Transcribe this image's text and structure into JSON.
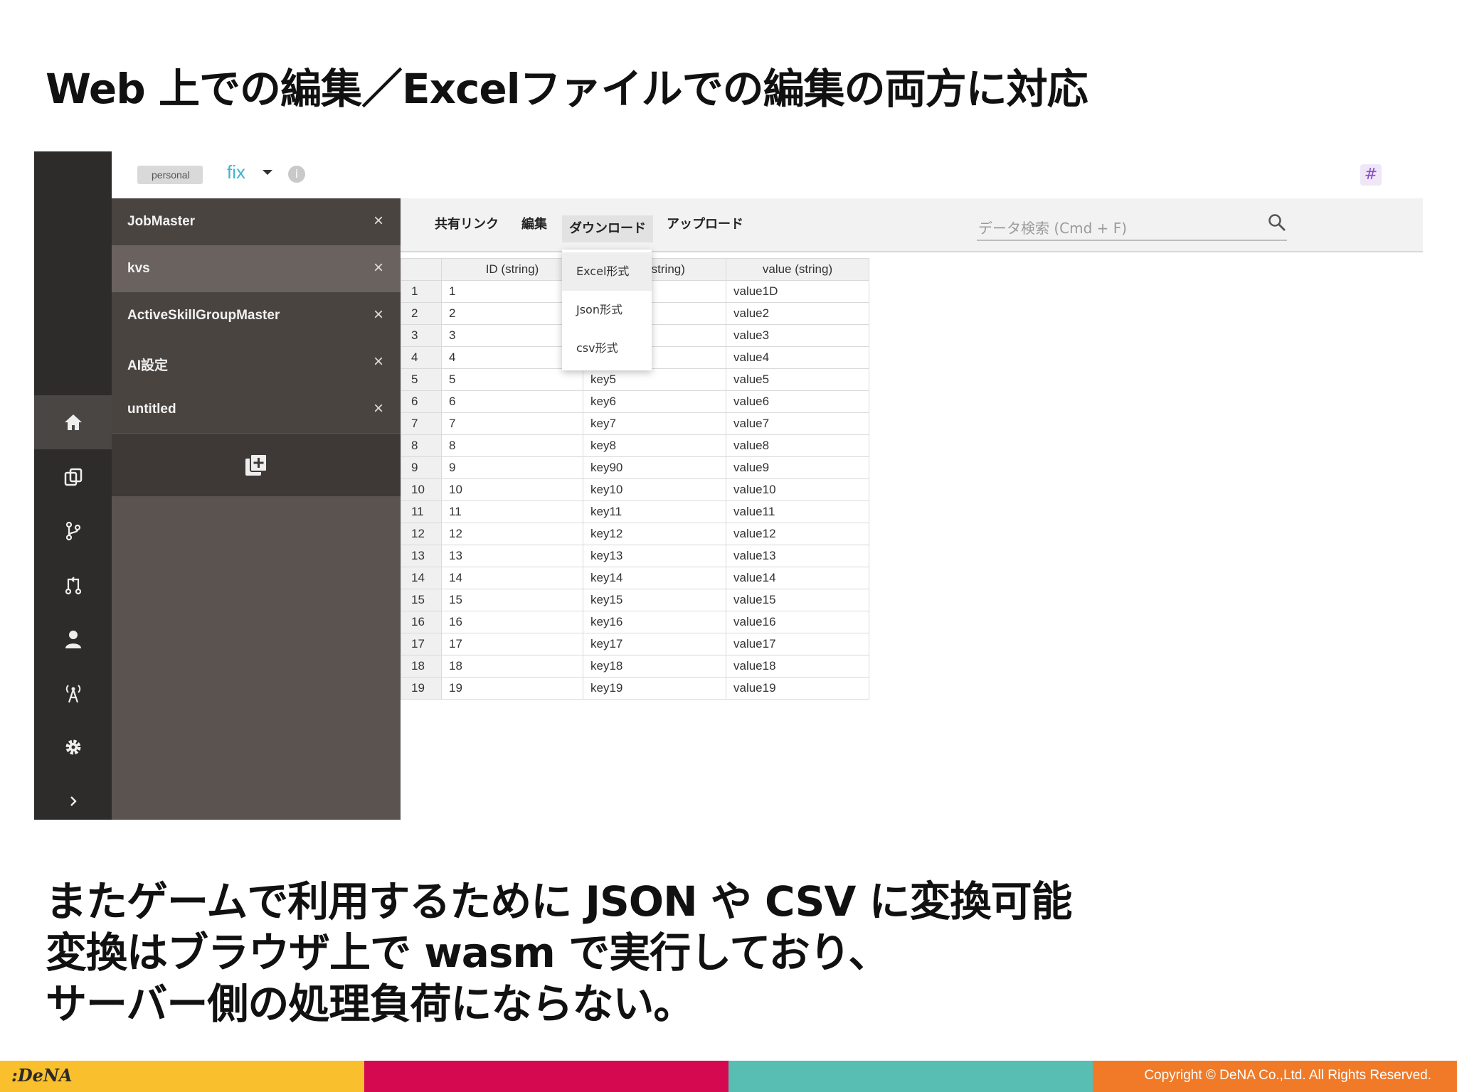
{
  "slide": {
    "title": "Web 上での編集／Excelファイルでの編集の両方に対応",
    "body_lines": [
      "またゲームで利用するために JSON や CSV に変換可能",
      "変換はブラウザ上で wasm で実行しており、",
      "サーバー側の処理負荷にならない。"
    ]
  },
  "app": {
    "env_badge": "personal",
    "branch": "fix",
    "sidebar_icons": [
      "home-icon",
      "copy-icon",
      "branch-icon",
      "pull-request-icon",
      "user-icon",
      "broadcast-icon",
      "gear-icon",
      "chevron-right-icon"
    ],
    "tabs": [
      {
        "label": "JobMaster",
        "close": "×"
      },
      {
        "label": "kvs",
        "close": "×"
      },
      {
        "label": "ActiveSkillGroupMaster",
        "close": "×"
      },
      {
        "label": "AI設定",
        "close": "×"
      },
      {
        "label": "untitled",
        "close": "×"
      }
    ],
    "selected_tab": "kvs",
    "menu": {
      "share": "共有リンク",
      "edit": "編集",
      "download": "ダウンロード",
      "upload": "アップロード"
    },
    "download_menu": [
      "Excel形式",
      "Json形式",
      "csv形式"
    ],
    "search": {
      "placeholder": "データ検索 (Cmd + F)"
    },
    "table": {
      "columns": [
        "ID (string)",
        "(string)",
        "value (string)"
      ],
      "rows": [
        [
          "1",
          "1",
          "",
          "value1D"
        ],
        [
          "2",
          "2",
          "",
          "value2"
        ],
        [
          "3",
          "3",
          "",
          "value3"
        ],
        [
          "4",
          "4",
          "",
          "value4"
        ],
        [
          "5",
          "5",
          "key5",
          "value5"
        ],
        [
          "6",
          "6",
          "key6",
          "value6"
        ],
        [
          "7",
          "7",
          "key7",
          "value7"
        ],
        [
          "8",
          "8",
          "key8",
          "value8"
        ],
        [
          "9",
          "9",
          "key90",
          "value9"
        ],
        [
          "10",
          "10",
          "key10",
          "value10"
        ],
        [
          "11",
          "11",
          "key11",
          "value11"
        ],
        [
          "12",
          "12",
          "key12",
          "value12"
        ],
        [
          "13",
          "13",
          "key13",
          "value13"
        ],
        [
          "14",
          "14",
          "key14",
          "value14"
        ],
        [
          "15",
          "15",
          "key15",
          "value15"
        ],
        [
          "16",
          "16",
          "key16",
          "value16"
        ],
        [
          "17",
          "17",
          "key17",
          "value17"
        ],
        [
          "18",
          "18",
          "key18",
          "value18"
        ],
        [
          "19",
          "19",
          "key19",
          "value19"
        ]
      ]
    }
  },
  "footer": {
    "logo": ":DeNA",
    "copyright": "Copyright © DeNA Co.,Ltd. All Rights Reserved.",
    "colors": [
      "#f9bf2c",
      "#d4094f",
      "#58bdb3",
      "#f07a27"
    ]
  }
}
